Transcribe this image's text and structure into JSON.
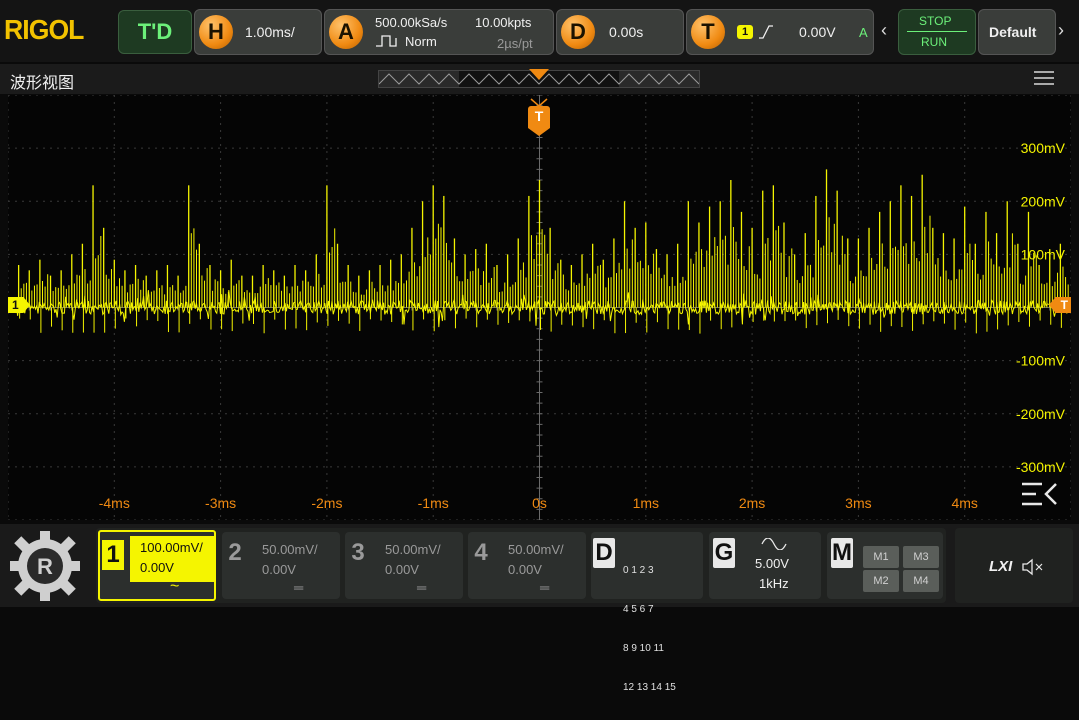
{
  "logo": "RIGOL",
  "trigger_mode": "T'D",
  "horizontal": {
    "letter": "H",
    "value": "1.00ms/"
  },
  "acquire": {
    "letter": "A",
    "rate": "500.00kSa/s",
    "points": "10.00kpts",
    "mode": "Norm",
    "time_per_pt": "2µs/pt"
  },
  "delay": {
    "letter": "D",
    "value": "0.00s"
  },
  "trigger": {
    "letter": "T",
    "channel": "1",
    "level": "0.00V",
    "sweep": "A"
  },
  "run_control": {
    "stop": "STOP",
    "run": "RUN"
  },
  "default_button": "Default",
  "wave_view_title": "波形视图",
  "trigger_marker": "T",
  "ch1_marker": "1",
  "y_labels": [
    "300mV",
    "200mV",
    "100mV",
    "-100mV",
    "-200mV",
    "-300mV"
  ],
  "x_labels": [
    "-4ms",
    "-3ms",
    "-2ms",
    "-1ms",
    "0s",
    "1ms",
    "2ms",
    "3ms",
    "4ms"
  ],
  "channels": [
    {
      "num": "1",
      "scale": "100.00mV/",
      "offset": "0.00V",
      "coupling": "~",
      "active": true,
      "color": "#f5f500"
    },
    {
      "num": "2",
      "scale": "50.00mV/",
      "offset": "0.00V",
      "coupling": "═",
      "active": false,
      "color": "#9a9a9a"
    },
    {
      "num": "3",
      "scale": "50.00mV/",
      "offset": "0.00V",
      "coupling": "═",
      "active": false,
      "color": "#9a9a9a"
    },
    {
      "num": "4",
      "scale": "50.00mV/",
      "offset": "0.00V",
      "coupling": "═",
      "active": false,
      "color": "#9a9a9a"
    }
  ],
  "digital": {
    "letter": "D",
    "rows": [
      "0 1 2 3",
      "4 5 6 7",
      "8 9 10 11",
      "12 13 14 15"
    ]
  },
  "generator": {
    "letter": "G",
    "amplitude": "5.00V",
    "freq": "1kHz"
  },
  "math": {
    "letter": "M",
    "buttons": [
      "M1",
      "M3",
      "M2",
      "M4"
    ]
  },
  "lxi": "LXI",
  "colors": {
    "ch1": "#f5f500",
    "accent": "#f08a12",
    "grid_label": "#f5f500",
    "time_label": "#f08a12"
  },
  "chart_data": {
    "type": "line",
    "title": "",
    "xlabel": "",
    "ylabel": "",
    "xlim": [
      -5,
      5
    ],
    "ylim": [
      -400,
      400
    ],
    "x": [
      -4.9,
      -4.8,
      -4.7,
      -4.6,
      -4.5,
      -4.4,
      -4.3,
      -4.2,
      -4.1,
      -4.0,
      -3.9,
      -3.8,
      -3.7,
      -3.6,
      -3.5,
      -3.4,
      -3.3,
      -3.2,
      -3.1,
      -3.0,
      -2.9,
      -2.8,
      -2.7,
      -2.6,
      -2.5,
      -2.4,
      -2.3,
      -2.2,
      -2.1,
      -2.0,
      -1.9,
      -1.8,
      -1.7,
      -1.6,
      -1.5,
      -1.4,
      -1.3,
      -1.2,
      -1.1,
      -1.0,
      -0.9,
      -0.8,
      -0.7,
      -0.6,
      -0.5,
      -0.4,
      -0.3,
      -0.2,
      -0.1,
      0.0,
      0.1,
      0.2,
      0.3,
      0.4,
      0.5,
      0.6,
      0.7,
      0.8,
      0.9,
      1.0,
      1.1,
      1.2,
      1.3,
      1.4,
      1.5,
      1.6,
      1.7,
      1.8,
      1.9,
      2.0,
      2.1,
      2.2,
      2.3,
      2.4,
      2.5,
      2.6,
      2.7,
      2.8,
      2.9,
      3.0,
      3.1,
      3.2,
      3.3,
      3.4,
      3.5,
      3.6,
      3.7,
      3.8,
      3.9,
      4.0,
      4.1,
      4.2,
      4.3,
      4.4,
      4.5,
      4.6,
      4.7,
      4.8,
      4.9
    ],
    "series": [
      {
        "name": "",
        "values": [
          80,
          70,
          90,
          60,
          70,
          100,
          120,
          230,
          150,
          90,
          70,
          80,
          60,
          70,
          80,
          60,
          230,
          120,
          80,
          70,
          90,
          60,
          60,
          80,
          70,
          60,
          80,
          70,
          100,
          230,
          120,
          80,
          60,
          70,
          80,
          90,
          100,
          150,
          200,
          230,
          210,
          130,
          100,
          110,
          120,
          80,
          100,
          130,
          210,
          240,
          150,
          90,
          80,
          100,
          120,
          90,
          130,
          200,
          150,
          160,
          110,
          100,
          120,
          200,
          160,
          190,
          200,
          240,
          180,
          150,
          220,
          230,
          160,
          100,
          140,
          210,
          260,
          220,
          130,
          130,
          150,
          180,
          200,
          230,
          210,
          250,
          150,
          140,
          130,
          190,
          120,
          180,
          140,
          200,
          120,
          180,
          80,
          110,
          120
        ]
      }
    ]
  }
}
